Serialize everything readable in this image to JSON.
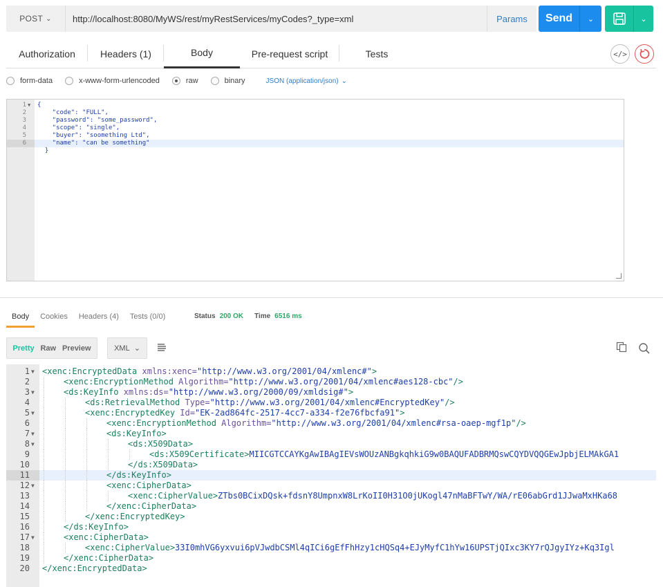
{
  "request": {
    "method": "POST",
    "url": "http://localhost:8080/MyWS/rest/myRestServices/myCodes?_type=xml",
    "params_label": "Params",
    "send_label": "Send"
  },
  "request_tabs": [
    {
      "label": "Authorization"
    },
    {
      "label": "Headers (1)"
    },
    {
      "label": "Body",
      "active": true
    },
    {
      "label": "Pre-request script"
    },
    {
      "label": "Tests"
    }
  ],
  "body_types": [
    {
      "label": "form-data",
      "selected": false
    },
    {
      "label": "x-www-form-urlencoded",
      "selected": false
    },
    {
      "label": "raw",
      "selected": true
    },
    {
      "label": "binary",
      "selected": false
    }
  ],
  "content_type": "JSON (application/json)",
  "request_body": [
    {
      "n": "1",
      "fold": true,
      "text": "{"
    },
    {
      "n": "2",
      "text": "    \"code\": \"FULL\","
    },
    {
      "n": "3",
      "text": "    \"password\": \"some_password\","
    },
    {
      "n": "4",
      "text": "    \"scope\": \"single\","
    },
    {
      "n": "5",
      "text": "    \"buyer\": \"soomething Ltd\","
    },
    {
      "n": "6",
      "text": "    \"name\": \"can be something\"",
      "highlight": true
    },
    {
      "n": "",
      "text": "  }"
    }
  ],
  "response_tabs": [
    {
      "label": "Body",
      "active": true
    },
    {
      "label": "Cookies"
    },
    {
      "label": "Headers (4)"
    },
    {
      "label": "Tests (0/0)"
    }
  ],
  "status": {
    "status_label": "Status",
    "status_value": "200 OK",
    "time_label": "Time",
    "time_value": "6516 ms"
  },
  "view_modes": [
    "Pretty",
    "Raw",
    "Preview"
  ],
  "active_view": "Pretty",
  "format": "XML",
  "response_lines": [
    {
      "n": "1",
      "fold": true,
      "indent": 0,
      "parts": [
        [
          "tag",
          "<xenc:EncryptedData "
        ],
        [
          "attr",
          "xmlns:xenc="
        ],
        [
          "val",
          "\"http://www.w3.org/2001/04/xmlenc#\""
        ],
        [
          "tag",
          ">"
        ]
      ]
    },
    {
      "n": "2",
      "indent": 1,
      "parts": [
        [
          "tag",
          "<xenc:EncryptionMethod "
        ],
        [
          "attr",
          "Algorithm="
        ],
        [
          "val",
          "\"http://www.w3.org/2001/04/xmlenc#aes128-cbc\""
        ],
        [
          "tag",
          "/>"
        ]
      ]
    },
    {
      "n": "3",
      "fold": true,
      "indent": 1,
      "parts": [
        [
          "tag",
          "<ds:KeyInfo "
        ],
        [
          "attr",
          "xmlns:ds="
        ],
        [
          "val",
          "\"http://www.w3.org/2000/09/xmldsig#\""
        ],
        [
          "tag",
          ">"
        ]
      ]
    },
    {
      "n": "4",
      "indent": 2,
      "parts": [
        [
          "tag",
          "<ds:RetrievalMethod "
        ],
        [
          "attr",
          "Type="
        ],
        [
          "val",
          "\"http://www.w3.org/2001/04/xmlenc#EncryptedKey\""
        ],
        [
          "tag",
          "/>"
        ]
      ]
    },
    {
      "n": "5",
      "fold": true,
      "indent": 2,
      "parts": [
        [
          "tag",
          "<xenc:EncryptedKey "
        ],
        [
          "attr",
          "Id="
        ],
        [
          "val",
          "\"EK-2ad864fc-2517-4cc7-a334-f2e76fbcfa91\""
        ],
        [
          "tag",
          ">"
        ]
      ]
    },
    {
      "n": "6",
      "indent": 3,
      "parts": [
        [
          "tag",
          "<xenc:EncryptionMethod "
        ],
        [
          "attr",
          "Algorithm="
        ],
        [
          "val",
          "\"http://www.w3.org/2001/04/xmlenc#rsa-oaep-mgf1p\""
        ],
        [
          "tag",
          "/>"
        ]
      ]
    },
    {
      "n": "7",
      "fold": true,
      "indent": 3,
      "parts": [
        [
          "tag",
          "<ds:KeyInfo>"
        ]
      ]
    },
    {
      "n": "8",
      "fold": true,
      "indent": 4,
      "parts": [
        [
          "tag",
          "<ds:X509Data>"
        ]
      ]
    },
    {
      "n": "9",
      "indent": 5,
      "parts": [
        [
          "tag",
          "<ds:X509Certificate>"
        ],
        [
          "txtc",
          "MIICGTCCAYKgAwIBAgIEVsWOUzANBgkqhkiG9w0BAQUFADBRMQswCQYDVQQGEwJpbjELMAkGA1"
        ]
      ]
    },
    {
      "n": "10",
      "indent": 4,
      "parts": [
        [
          "tag",
          "</ds:X509Data>"
        ]
      ]
    },
    {
      "n": "11",
      "indent": 3,
      "highlight": true,
      "parts": [
        [
          "tag",
          "</ds:KeyInfo>"
        ]
      ]
    },
    {
      "n": "12",
      "fold": true,
      "indent": 3,
      "parts": [
        [
          "tag",
          "<xenc:CipherData>"
        ]
      ]
    },
    {
      "n": "13",
      "indent": 4,
      "parts": [
        [
          "tag",
          "<xenc:CipherValue>"
        ],
        [
          "txtc",
          "ZTbs0BCixDQsk+fdsnY8UmpnxW8LrKoII0H31O0jUKogl47nMaBFTwY/WA/rE06abGrd1JJwaMxHKa68"
        ]
      ]
    },
    {
      "n": "14",
      "indent": 3,
      "parts": [
        [
          "tag",
          "</xenc:CipherData>"
        ]
      ]
    },
    {
      "n": "15",
      "indent": 2,
      "parts": [
        [
          "tag",
          "</xenc:EncryptedKey>"
        ]
      ]
    },
    {
      "n": "16",
      "indent": 1,
      "parts": [
        [
          "tag",
          "</ds:KeyInfo>"
        ]
      ]
    },
    {
      "n": "17",
      "fold": true,
      "indent": 1,
      "parts": [
        [
          "tag",
          "<xenc:CipherData>"
        ]
      ]
    },
    {
      "n": "18",
      "indent": 2,
      "parts": [
        [
          "tag",
          "<xenc:CipherValue>"
        ],
        [
          "txtc",
          "33I0mhVG6yxvui6pVJwdbCSMl4qICi6gEfFhHzy1cHQSq4+EJyMyfC1hYw16UPSTjQIxc3KY7rQJgyIYz+Kq3Igl"
        ]
      ]
    },
    {
      "n": "19",
      "indent": 1,
      "parts": [
        [
          "tag",
          "</xenc:CipherData>"
        ]
      ]
    },
    {
      "n": "20",
      "indent": 0,
      "parts": [
        [
          "tag",
          "</xenc:EncryptedData>"
        ]
      ]
    }
  ],
  "colors": {
    "send": "#1d8cef",
    "save": "#18c3a0",
    "status_ok": "#2aa868",
    "active_response_tab": "#f0a030"
  }
}
